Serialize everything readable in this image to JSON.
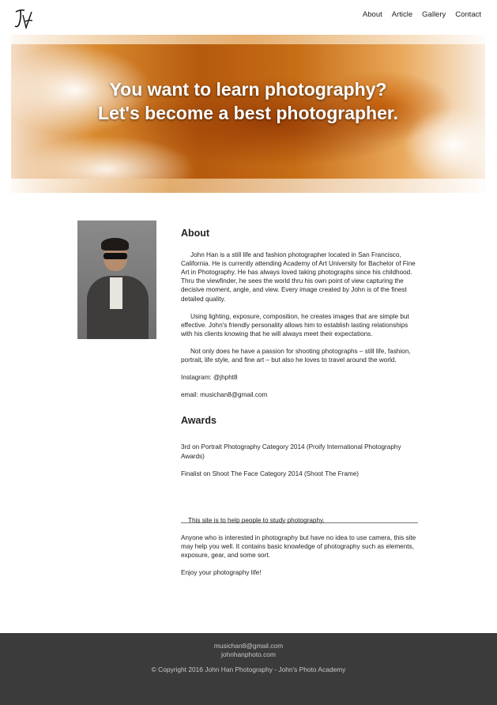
{
  "nav": {
    "items": [
      "About",
      "Article",
      "Gallery",
      "Contact"
    ]
  },
  "hero": {
    "line1": "You want to learn photography?",
    "line2": "Let's become a best photographer."
  },
  "about": {
    "title": "About",
    "paragraphs": [
      "John Han is a still life and fashion photographer located in San Francisco, California. He is currently attending Academy of Art University for Bachelor of Fine Art in Photography. He has always loved taking photographs since his childhood. Thru the viewfinder, he sees the world thru his own point of view capturing the decisive moment, angle, and view. Every image created by John is of the finest detailed quality.",
      "Using lighting, exposure, composition, he creates images that are simple but effective. John's friendly personality allows him to establish lasting relationships with his clients knowing that he will always meet their expectations.",
      "Not only does he have a passion for shooting photographs – still life, fashion, portrait, life style, and fine art – but also he loves to travel around the world."
    ],
    "instagram": "Instagram: @jhpht8",
    "email": "email: musichan8@gmail.com"
  },
  "awards": {
    "title": "Awards",
    "items": [
      "3rd on Portrait Photography Category 2014 (Proify International Photography Awards)",
      "Finalist on Shoot The Face Category 2014 (Shoot The Frame)"
    ]
  },
  "site_info": {
    "intro": "This site is to help people to study photography.",
    "body": "Anyone who is interested in photography but have no idea to use camera, this site may help you well. It contains basic knowledge of photography such as elements, exposure, gear, and some sort.",
    "closing": "Enjoy your photography life!"
  },
  "footer": {
    "email": "musichan8@gmail.com",
    "website": "johnhanphoto.com",
    "copyright": "© Copyright 2016 John Han Photography - John's Photo Academy"
  }
}
